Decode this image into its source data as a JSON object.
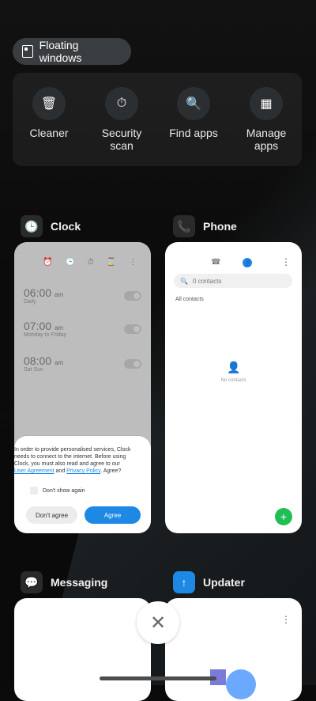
{
  "header": {
    "floating_label": "Floating windows",
    "floating_icon": "floating-window-icon"
  },
  "quick_actions": [
    {
      "icon": "trash-icon",
      "label": "Cleaner"
    },
    {
      "icon": "shield-scan-icon",
      "label": "Security scan"
    },
    {
      "icon": "search-a-icon",
      "label": "Find apps"
    },
    {
      "icon": "grid-icon",
      "label": "Manage apps"
    }
  ],
  "apps": {
    "clock": {
      "title": "Clock",
      "alarms": [
        {
          "time": "06:00",
          "ampm": "am",
          "sub": "Daily"
        },
        {
          "time": "07:00",
          "ampm": "am",
          "sub": "Monday to Friday"
        },
        {
          "time": "08:00",
          "ampm": "am",
          "sub": "Sat Sun"
        }
      ],
      "consent": {
        "text_part1": "In order to provide personalised services, Clock needs to connect to the internet. Before using Clock, you must also read and agree to our ",
        "link1": "User Agreement",
        "and": " and ",
        "link2": "Privacy Policy",
        "text_part2": ". Agree?",
        "checkbox_label": "Don't show again",
        "btn_dont": "Don't agree",
        "btn_agree": "Agree"
      }
    },
    "phone": {
      "title": "Phone",
      "search_placeholder": "0 contacts",
      "filter_label": "All contacts",
      "empty_text": "No contacts"
    },
    "messaging": {
      "title": "Messaging"
    },
    "updater": {
      "title": "Updater"
    }
  },
  "controls": {
    "close_symbol": "✕"
  }
}
